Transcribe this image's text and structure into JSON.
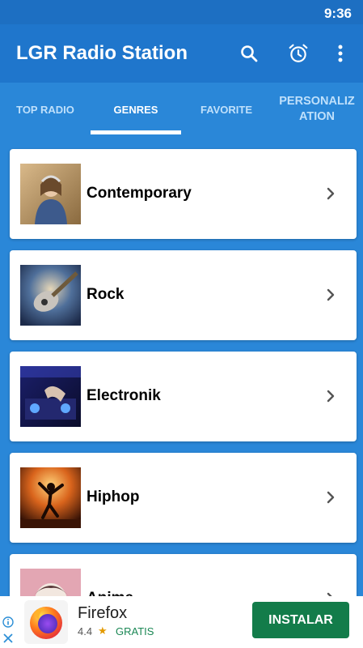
{
  "status_bar": {
    "time": "9:36"
  },
  "app_bar": {
    "title": "LGR Radio Station",
    "actions": [
      "search-icon",
      "alarm-clock-icon",
      "more-vert-icon"
    ]
  },
  "tabs": [
    {
      "label": "TOP RADIO",
      "active": false
    },
    {
      "label": "GENRES",
      "active": true
    },
    {
      "label": "FAVORITE",
      "active": false
    },
    {
      "label": "PERSONALIZATION",
      "active": false
    }
  ],
  "genres": [
    {
      "name": "Contemporary",
      "thumbnail": "woman-with-headphones-photo"
    },
    {
      "name": "Rock",
      "thumbnail": "electric-guitar-photo"
    },
    {
      "name": "Electronik",
      "thumbnail": "dj-mixer-photo"
    },
    {
      "name": "Hiphop",
      "thumbnail": "dancer-silhouette-photo"
    },
    {
      "name": "Anime",
      "thumbnail": "anime-character-photo"
    }
  ],
  "ad": {
    "app_name": "Firefox",
    "rating": "4.4",
    "price": "GRATIS",
    "install_label": "INSTALAR",
    "icons": [
      "info-icon",
      "close-icon",
      "firefox-logo-icon",
      "star-icon"
    ]
  },
  "colors": {
    "status_bar": "#1d6fc2",
    "app_bar": "#1f76cc",
    "background": "#2a87d8",
    "install_button": "#137c4a"
  }
}
